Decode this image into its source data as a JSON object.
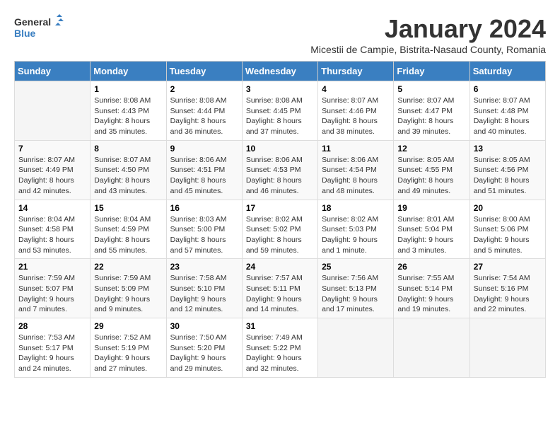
{
  "logo": {
    "text_general": "General",
    "text_blue": "Blue"
  },
  "header": {
    "month_title": "January 2024",
    "subtitle": "Micestii de Campie, Bistrita-Nasaud County, Romania"
  },
  "weekdays": [
    "Sunday",
    "Monday",
    "Tuesday",
    "Wednesday",
    "Thursday",
    "Friday",
    "Saturday"
  ],
  "weeks": [
    [
      {
        "day": "",
        "info": ""
      },
      {
        "day": "1",
        "info": "Sunrise: 8:08 AM\nSunset: 4:43 PM\nDaylight: 8 hours\nand 35 minutes."
      },
      {
        "day": "2",
        "info": "Sunrise: 8:08 AM\nSunset: 4:44 PM\nDaylight: 8 hours\nand 36 minutes."
      },
      {
        "day": "3",
        "info": "Sunrise: 8:08 AM\nSunset: 4:45 PM\nDaylight: 8 hours\nand 37 minutes."
      },
      {
        "day": "4",
        "info": "Sunrise: 8:07 AM\nSunset: 4:46 PM\nDaylight: 8 hours\nand 38 minutes."
      },
      {
        "day": "5",
        "info": "Sunrise: 8:07 AM\nSunset: 4:47 PM\nDaylight: 8 hours\nand 39 minutes."
      },
      {
        "day": "6",
        "info": "Sunrise: 8:07 AM\nSunset: 4:48 PM\nDaylight: 8 hours\nand 40 minutes."
      }
    ],
    [
      {
        "day": "7",
        "info": "Sunrise: 8:07 AM\nSunset: 4:49 PM\nDaylight: 8 hours\nand 42 minutes."
      },
      {
        "day": "8",
        "info": "Sunrise: 8:07 AM\nSunset: 4:50 PM\nDaylight: 8 hours\nand 43 minutes."
      },
      {
        "day": "9",
        "info": "Sunrise: 8:06 AM\nSunset: 4:51 PM\nDaylight: 8 hours\nand 45 minutes."
      },
      {
        "day": "10",
        "info": "Sunrise: 8:06 AM\nSunset: 4:53 PM\nDaylight: 8 hours\nand 46 minutes."
      },
      {
        "day": "11",
        "info": "Sunrise: 8:06 AM\nSunset: 4:54 PM\nDaylight: 8 hours\nand 48 minutes."
      },
      {
        "day": "12",
        "info": "Sunrise: 8:05 AM\nSunset: 4:55 PM\nDaylight: 8 hours\nand 49 minutes."
      },
      {
        "day": "13",
        "info": "Sunrise: 8:05 AM\nSunset: 4:56 PM\nDaylight: 8 hours\nand 51 minutes."
      }
    ],
    [
      {
        "day": "14",
        "info": "Sunrise: 8:04 AM\nSunset: 4:58 PM\nDaylight: 8 hours\nand 53 minutes."
      },
      {
        "day": "15",
        "info": "Sunrise: 8:04 AM\nSunset: 4:59 PM\nDaylight: 8 hours\nand 55 minutes."
      },
      {
        "day": "16",
        "info": "Sunrise: 8:03 AM\nSunset: 5:00 PM\nDaylight: 8 hours\nand 57 minutes."
      },
      {
        "day": "17",
        "info": "Sunrise: 8:02 AM\nSunset: 5:02 PM\nDaylight: 8 hours\nand 59 minutes."
      },
      {
        "day": "18",
        "info": "Sunrise: 8:02 AM\nSunset: 5:03 PM\nDaylight: 9 hours\nand 1 minute."
      },
      {
        "day": "19",
        "info": "Sunrise: 8:01 AM\nSunset: 5:04 PM\nDaylight: 9 hours\nand 3 minutes."
      },
      {
        "day": "20",
        "info": "Sunrise: 8:00 AM\nSunset: 5:06 PM\nDaylight: 9 hours\nand 5 minutes."
      }
    ],
    [
      {
        "day": "21",
        "info": "Sunrise: 7:59 AM\nSunset: 5:07 PM\nDaylight: 9 hours\nand 7 minutes."
      },
      {
        "day": "22",
        "info": "Sunrise: 7:59 AM\nSunset: 5:09 PM\nDaylight: 9 hours\nand 9 minutes."
      },
      {
        "day": "23",
        "info": "Sunrise: 7:58 AM\nSunset: 5:10 PM\nDaylight: 9 hours\nand 12 minutes."
      },
      {
        "day": "24",
        "info": "Sunrise: 7:57 AM\nSunset: 5:11 PM\nDaylight: 9 hours\nand 14 minutes."
      },
      {
        "day": "25",
        "info": "Sunrise: 7:56 AM\nSunset: 5:13 PM\nDaylight: 9 hours\nand 17 minutes."
      },
      {
        "day": "26",
        "info": "Sunrise: 7:55 AM\nSunset: 5:14 PM\nDaylight: 9 hours\nand 19 minutes."
      },
      {
        "day": "27",
        "info": "Sunrise: 7:54 AM\nSunset: 5:16 PM\nDaylight: 9 hours\nand 22 minutes."
      }
    ],
    [
      {
        "day": "28",
        "info": "Sunrise: 7:53 AM\nSunset: 5:17 PM\nDaylight: 9 hours\nand 24 minutes."
      },
      {
        "day": "29",
        "info": "Sunrise: 7:52 AM\nSunset: 5:19 PM\nDaylight: 9 hours\nand 27 minutes."
      },
      {
        "day": "30",
        "info": "Sunrise: 7:50 AM\nSunset: 5:20 PM\nDaylight: 9 hours\nand 29 minutes."
      },
      {
        "day": "31",
        "info": "Sunrise: 7:49 AM\nSunset: 5:22 PM\nDaylight: 9 hours\nand 32 minutes."
      },
      {
        "day": "",
        "info": ""
      },
      {
        "day": "",
        "info": ""
      },
      {
        "day": "",
        "info": ""
      }
    ]
  ]
}
